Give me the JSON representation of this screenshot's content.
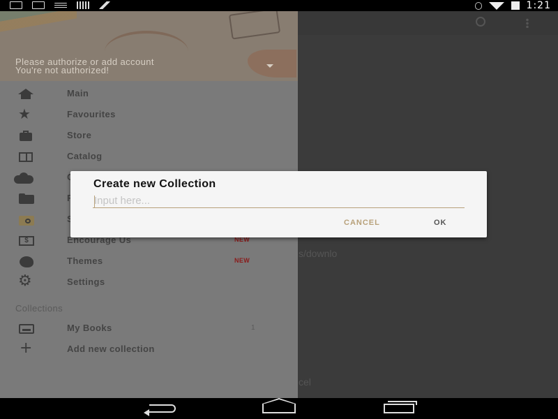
{
  "status_bar": {
    "time": "1:21",
    "icons": [
      "download-icon",
      "message-icon",
      "sync-icon",
      "barcode-icon",
      "airplane-icon",
      "bluetooth-icon",
      "wifi-icon",
      "battery-charging-icon"
    ]
  },
  "background": {
    "toolbar_icons": [
      "search-icon",
      "more-vert-icon"
    ],
    "partial_texts": [
      "s/downlo",
      "cel"
    ]
  },
  "drawer": {
    "header": {
      "line1": "Please authorize or add account",
      "line2": "You're not authorized!"
    },
    "items": [
      {
        "label": "Main",
        "icon": "home-icon"
      },
      {
        "label": "Favourites",
        "icon": "star-icon"
      },
      {
        "label": "Store",
        "icon": "briefcase-icon"
      },
      {
        "label": "Catalog",
        "icon": "books-icon"
      },
      {
        "label": "C",
        "icon": "cloud-icon"
      },
      {
        "label": "F",
        "icon": "folder-icon"
      },
      {
        "label": "S",
        "icon": "scan-folder-icon"
      },
      {
        "label": "Encourage Us",
        "icon": "dollar-icon",
        "badge": "NEW"
      },
      {
        "label": "Themes",
        "icon": "palette-icon",
        "badge": "NEW"
      },
      {
        "label": "Settings",
        "icon": "gear-icon"
      }
    ],
    "collections_header": "Collections",
    "collections": [
      {
        "label": "My Books",
        "icon": "inbox-icon",
        "count": "1"
      },
      {
        "label": "Add new collection",
        "icon": "plus-icon"
      }
    ]
  },
  "dialog": {
    "title": "Create new Collection",
    "input_placeholder": "Input here...",
    "input_value": "",
    "cancel_label": "CANCEL",
    "ok_label": "OK"
  },
  "colors": {
    "accent": "#b8a17a",
    "badge": "#8a1a1a"
  }
}
